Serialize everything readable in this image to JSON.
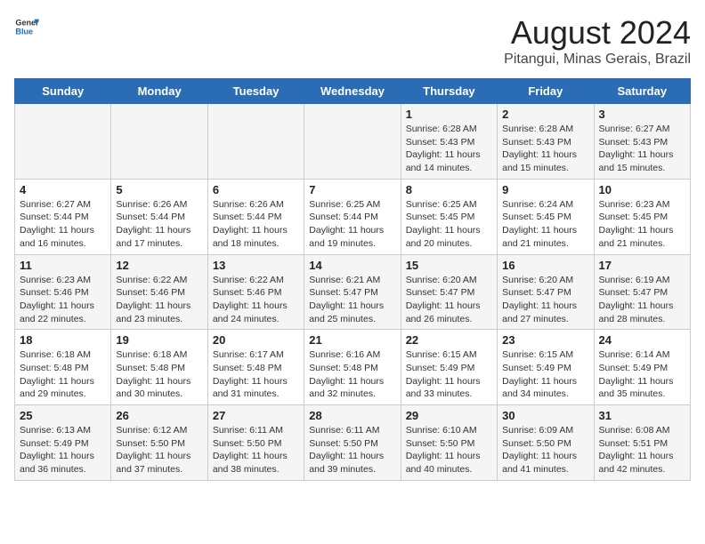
{
  "header": {
    "logo_line1": "General",
    "logo_line2": "Blue",
    "main_title": "August 2024",
    "subtitle": "Pitangui, Minas Gerais, Brazil"
  },
  "days_of_week": [
    "Sunday",
    "Monday",
    "Tuesday",
    "Wednesday",
    "Thursday",
    "Friday",
    "Saturday"
  ],
  "weeks": [
    [
      {
        "day": "",
        "info": ""
      },
      {
        "day": "",
        "info": ""
      },
      {
        "day": "",
        "info": ""
      },
      {
        "day": "",
        "info": ""
      },
      {
        "day": "1",
        "info": "Sunrise: 6:28 AM\nSunset: 5:43 PM\nDaylight: 11 hours\nand 14 minutes."
      },
      {
        "day": "2",
        "info": "Sunrise: 6:28 AM\nSunset: 5:43 PM\nDaylight: 11 hours\nand 15 minutes."
      },
      {
        "day": "3",
        "info": "Sunrise: 6:27 AM\nSunset: 5:43 PM\nDaylight: 11 hours\nand 15 minutes."
      }
    ],
    [
      {
        "day": "4",
        "info": "Sunrise: 6:27 AM\nSunset: 5:44 PM\nDaylight: 11 hours\nand 16 minutes."
      },
      {
        "day": "5",
        "info": "Sunrise: 6:26 AM\nSunset: 5:44 PM\nDaylight: 11 hours\nand 17 minutes."
      },
      {
        "day": "6",
        "info": "Sunrise: 6:26 AM\nSunset: 5:44 PM\nDaylight: 11 hours\nand 18 minutes."
      },
      {
        "day": "7",
        "info": "Sunrise: 6:25 AM\nSunset: 5:44 PM\nDaylight: 11 hours\nand 19 minutes."
      },
      {
        "day": "8",
        "info": "Sunrise: 6:25 AM\nSunset: 5:45 PM\nDaylight: 11 hours\nand 20 minutes."
      },
      {
        "day": "9",
        "info": "Sunrise: 6:24 AM\nSunset: 5:45 PM\nDaylight: 11 hours\nand 21 minutes."
      },
      {
        "day": "10",
        "info": "Sunrise: 6:23 AM\nSunset: 5:45 PM\nDaylight: 11 hours\nand 21 minutes."
      }
    ],
    [
      {
        "day": "11",
        "info": "Sunrise: 6:23 AM\nSunset: 5:46 PM\nDaylight: 11 hours\nand 22 minutes."
      },
      {
        "day": "12",
        "info": "Sunrise: 6:22 AM\nSunset: 5:46 PM\nDaylight: 11 hours\nand 23 minutes."
      },
      {
        "day": "13",
        "info": "Sunrise: 6:22 AM\nSunset: 5:46 PM\nDaylight: 11 hours\nand 24 minutes."
      },
      {
        "day": "14",
        "info": "Sunrise: 6:21 AM\nSunset: 5:47 PM\nDaylight: 11 hours\nand 25 minutes."
      },
      {
        "day": "15",
        "info": "Sunrise: 6:20 AM\nSunset: 5:47 PM\nDaylight: 11 hours\nand 26 minutes."
      },
      {
        "day": "16",
        "info": "Sunrise: 6:20 AM\nSunset: 5:47 PM\nDaylight: 11 hours\nand 27 minutes."
      },
      {
        "day": "17",
        "info": "Sunrise: 6:19 AM\nSunset: 5:47 PM\nDaylight: 11 hours\nand 28 minutes."
      }
    ],
    [
      {
        "day": "18",
        "info": "Sunrise: 6:18 AM\nSunset: 5:48 PM\nDaylight: 11 hours\nand 29 minutes."
      },
      {
        "day": "19",
        "info": "Sunrise: 6:18 AM\nSunset: 5:48 PM\nDaylight: 11 hours\nand 30 minutes."
      },
      {
        "day": "20",
        "info": "Sunrise: 6:17 AM\nSunset: 5:48 PM\nDaylight: 11 hours\nand 31 minutes."
      },
      {
        "day": "21",
        "info": "Sunrise: 6:16 AM\nSunset: 5:48 PM\nDaylight: 11 hours\nand 32 minutes."
      },
      {
        "day": "22",
        "info": "Sunrise: 6:15 AM\nSunset: 5:49 PM\nDaylight: 11 hours\nand 33 minutes."
      },
      {
        "day": "23",
        "info": "Sunrise: 6:15 AM\nSunset: 5:49 PM\nDaylight: 11 hours\nand 34 minutes."
      },
      {
        "day": "24",
        "info": "Sunrise: 6:14 AM\nSunset: 5:49 PM\nDaylight: 11 hours\nand 35 minutes."
      }
    ],
    [
      {
        "day": "25",
        "info": "Sunrise: 6:13 AM\nSunset: 5:49 PM\nDaylight: 11 hours\nand 36 minutes."
      },
      {
        "day": "26",
        "info": "Sunrise: 6:12 AM\nSunset: 5:50 PM\nDaylight: 11 hours\nand 37 minutes."
      },
      {
        "day": "27",
        "info": "Sunrise: 6:11 AM\nSunset: 5:50 PM\nDaylight: 11 hours\nand 38 minutes."
      },
      {
        "day": "28",
        "info": "Sunrise: 6:11 AM\nSunset: 5:50 PM\nDaylight: 11 hours\nand 39 minutes."
      },
      {
        "day": "29",
        "info": "Sunrise: 6:10 AM\nSunset: 5:50 PM\nDaylight: 11 hours\nand 40 minutes."
      },
      {
        "day": "30",
        "info": "Sunrise: 6:09 AM\nSunset: 5:50 PM\nDaylight: 11 hours\nand 41 minutes."
      },
      {
        "day": "31",
        "info": "Sunrise: 6:08 AM\nSunset: 5:51 PM\nDaylight: 11 hours\nand 42 minutes."
      }
    ]
  ]
}
